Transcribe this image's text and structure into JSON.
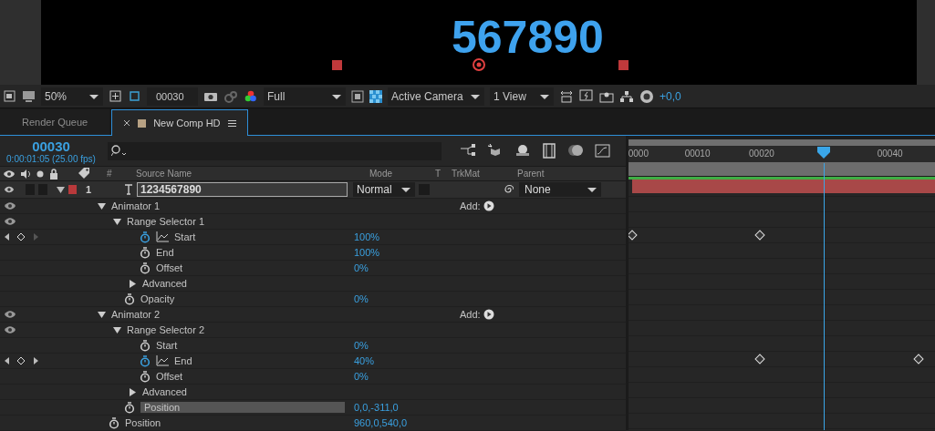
{
  "viewer": {
    "canvas_text": "567890"
  },
  "toolbar": {
    "zoom": "50%",
    "time": "00030",
    "resolution": "Full",
    "camera": "Active Camera",
    "views": "1 View",
    "exposure": "+0,0"
  },
  "tabs": [
    {
      "label": "Render Queue",
      "selected": false
    },
    {
      "label": "New Comp HD",
      "selected": true
    }
  ],
  "timecode": "00030",
  "timecode_detail": "0:00:01:05 (25.00 fps)",
  "columns": [
    "#",
    "Source Name",
    "Mode",
    "T",
    "TrkMat",
    "Parent"
  ],
  "ruler": {
    "ticks": [
      {
        "label": "0000",
        "level": 0.035
      },
      {
        "label": "00010",
        "level": 0.22
      },
      {
        "label": "00020",
        "level": 0.43
      },
      {
        "label": "00040",
        "level": 0.85
      }
    ],
    "cti": {
      "level": 0.64
    }
  },
  "layer": {
    "number": "1",
    "name": "1234567890",
    "color": "#b8393b",
    "mode": "Normal",
    "parent": "None",
    "solo": false,
    "locked": false,
    "expanded": true,
    "children": [
      {
        "kind": "group",
        "name": "Animator 1",
        "expanded": true,
        "visible": true,
        "add": "Add:",
        "children": [
          {
            "kind": "group",
            "name": "Range Selector 1",
            "expanded": true,
            "visible": true,
            "children": [
              {
                "kind": "property",
                "name": "Start",
                "value": "100%",
                "animated": true,
                "selected": false,
                "keyframes": [
                  {
                    "level": 0.012
                  },
                  {
                    "level": 0.43
                  }
                ]
              },
              {
                "kind": "property",
                "name": "End",
                "value": "100%",
                "animated": false,
                "selected": false
              },
              {
                "kind": "property",
                "name": "Offset",
                "value": "0%",
                "animated": false,
                "selected": false
              },
              {
                "kind": "group",
                "name": "Advanced",
                "expanded": false,
                "visible": false
              }
            ]
          },
          {
            "kind": "property",
            "name": "Opacity",
            "value": "0%",
            "animated": false,
            "selected": false
          }
        ]
      },
      {
        "kind": "group",
        "name": "Animator 2",
        "expanded": true,
        "visible": true,
        "add": "Add:",
        "children": [
          {
            "kind": "group",
            "name": "Range Selector 2",
            "expanded": true,
            "visible": true,
            "children": [
              {
                "kind": "property",
                "name": "Start",
                "value": "0%",
                "animated": false,
                "selected": false
              },
              {
                "kind": "property",
                "name": "End",
                "value": "40%",
                "animated": true,
                "selected": false,
                "keyframes": [
                  {
                    "level": 0.43
                  },
                  {
                    "level": 0.95
                  }
                ]
              },
              {
                "kind": "property",
                "name": "Offset",
                "value": "0%",
                "animated": false,
                "selected": false
              },
              {
                "kind": "group",
                "name": "Advanced",
                "expanded": false,
                "visible": false
              }
            ]
          },
          {
            "kind": "property",
            "name": "Position",
            "value": "0,0,-311,0",
            "animated": false,
            "selected": true
          }
        ]
      },
      {
        "kind": "property",
        "name": "Position",
        "value": "960,0,540,0",
        "animated": false,
        "selected": false
      }
    ]
  }
}
